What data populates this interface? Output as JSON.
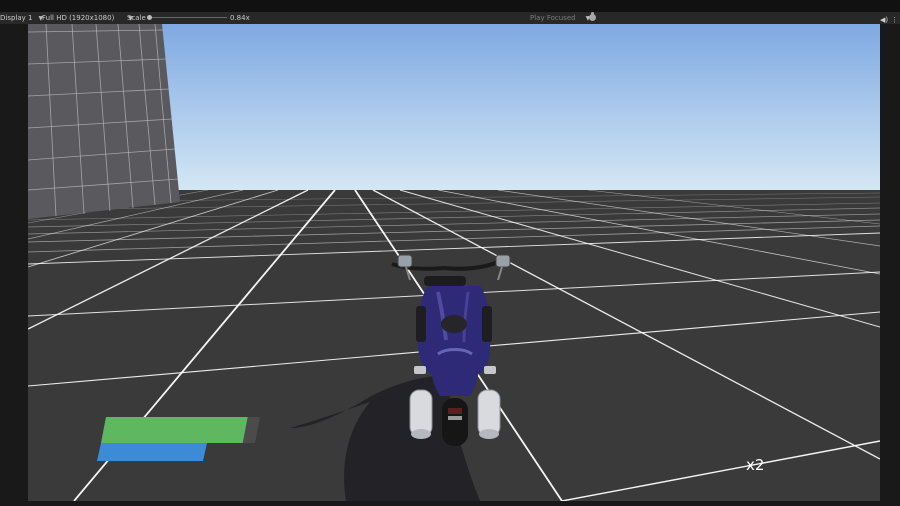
{
  "toolbar": {
    "display": "Display 1",
    "resolution": "Full HD (1920x1080)",
    "scale_label": "Scale",
    "scale_value": "0.84x",
    "play_mode": "Play Focused"
  },
  "hud": {
    "health_fill": 0.92,
    "stamina_fill": 1.0,
    "multiplier": "x2"
  },
  "colors": {
    "sky_top": "#7fa9e2",
    "sky_horizon": "#d4e7f4",
    "ground": "#3a3a3a",
    "grid_line": "#ffffff",
    "wall": "#5a5a5e",
    "health_bar": "#5fb860",
    "stamina_bar": "#3d8bd6",
    "motorcycle_body": "#2e2a78"
  },
  "icons": {
    "bug": "bug-icon",
    "speaker": "speaker-icon",
    "menu": "kebab-menu-icon"
  }
}
